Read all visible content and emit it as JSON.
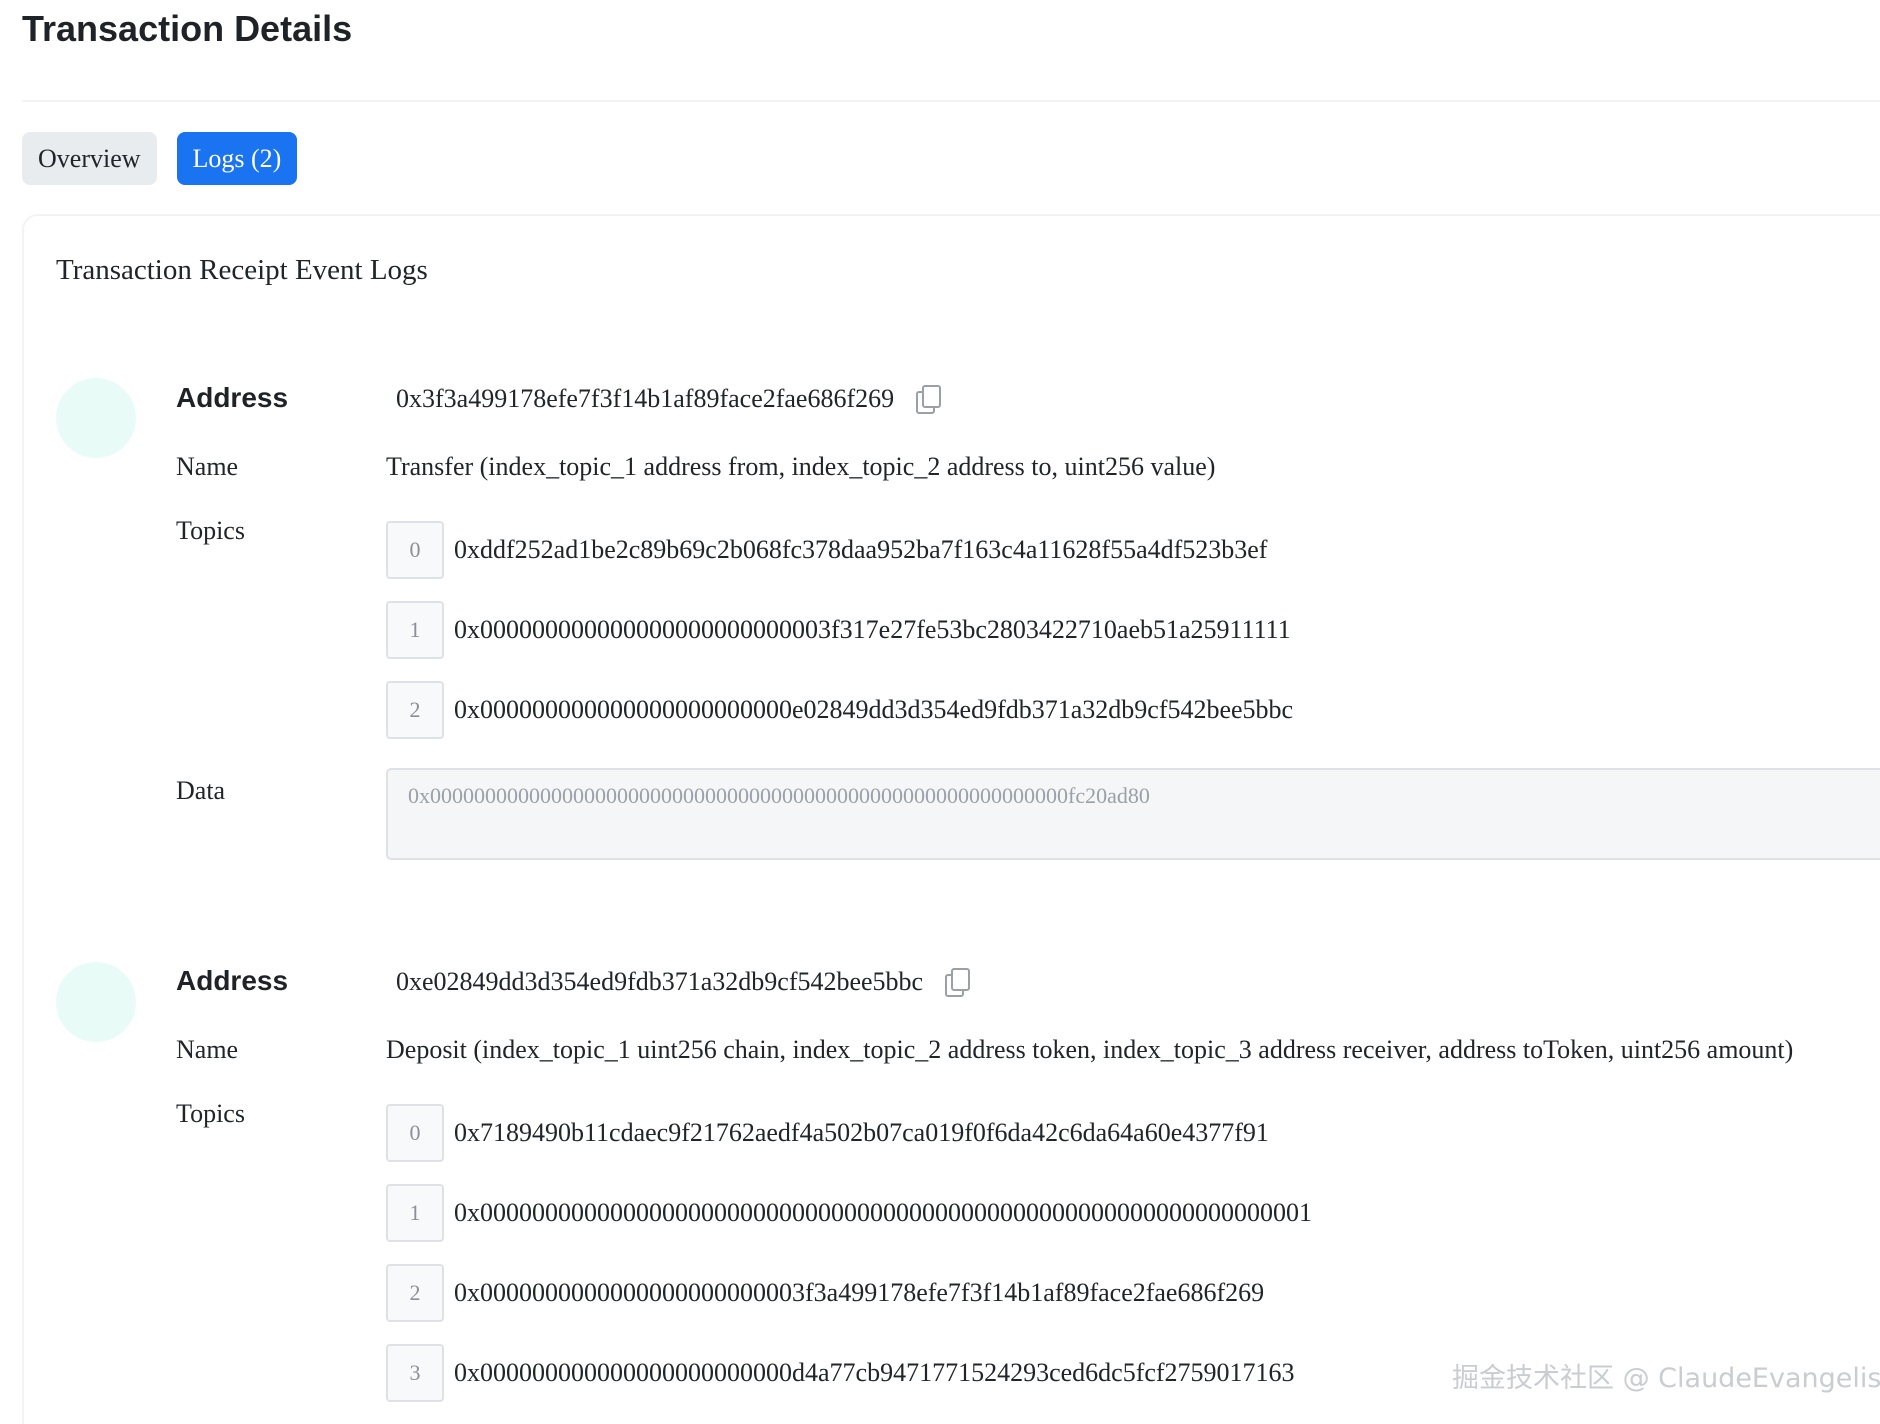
{
  "page": {
    "title": "Transaction Details"
  },
  "tabs": [
    {
      "label": "Overview",
      "active": false
    },
    {
      "label": "Logs (2)",
      "active": true
    }
  ],
  "card": {
    "title": "Transaction Receipt Event Logs"
  },
  "labels": {
    "address": "Address",
    "name": "Name",
    "topics": "Topics",
    "data": "Data"
  },
  "logs": [
    {
      "address": "0x3f3a499178efe7f3f14b1af89face2fae686f269",
      "name": "Transfer (index_topic_1 address from, index_topic_2 address to, uint256 value)",
      "topics": [
        {
          "index": "0",
          "value": "0xddf252ad1be2c89b69c2b068fc378daa952ba7f163c4a11628f55a4df523b3ef"
        },
        {
          "index": "1",
          "value": "0x000000000000000000000000003f317e27fe53bc2803422710aeb51a25911111"
        },
        {
          "index": "2",
          "value": "0x000000000000000000000000e02849dd3d354ed9fdb371a32db9cf542bee5bbc"
        }
      ],
      "data": "0x0000000000000000000000000000000000000000000000000000000000fc20ad80"
    },
    {
      "address": "0xe02849dd3d354ed9fdb371a32db9cf542bee5bbc",
      "name": "Deposit (index_topic_1 uint256 chain, index_topic_2 address token, index_topic_3 address receiver, address toToken, uint256 amount)",
      "topics": [
        {
          "index": "0",
          "value": "0x7189490b11cdaec9f21762aedf4a502b07ca019f0f6da42c6da64a60e4377f91"
        },
        {
          "index": "1",
          "value": "0x0000000000000000000000000000000000000000000000000000000000000001"
        },
        {
          "index": "2",
          "value": "0x0000000000000000000000003f3a499178efe7f3f14b1af89face2fae686f269"
        },
        {
          "index": "3",
          "value": "0x000000000000000000000000d4a77cb9471771524293ced6dc5fcf2759017163"
        }
      ]
    }
  ],
  "watermark": "掘金技术社区 @ ClaudeEvangelist",
  "colors": {
    "accent": "#1a73f0",
    "avatar": "#e9fbf6",
    "muted": "#9aa0a6"
  },
  "icons": {
    "copy": "copy-icon"
  }
}
